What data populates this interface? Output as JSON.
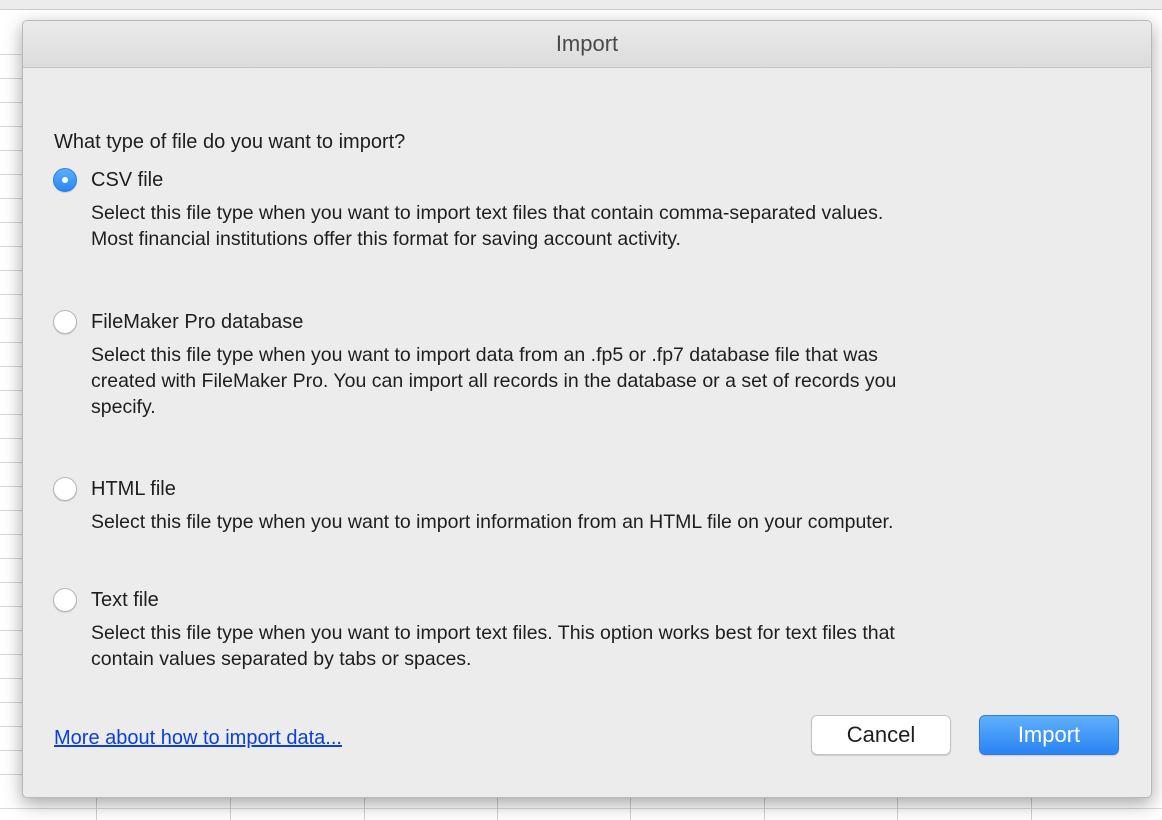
{
  "dialog": {
    "title": "Import",
    "question": "What type of file do you want to import?",
    "options": [
      {
        "label": "CSV file",
        "selected": true,
        "description": [
          "Select this file type when you want to import text files that contain comma-separated values.",
          "Most financial institutions offer this format for saving account activity."
        ]
      },
      {
        "label": "FileMaker Pro database",
        "selected": false,
        "description": [
          "Select this file type when you want to import data from an .fp5 or .fp7 database file that was",
          "created with FileMaker Pro.  You can import all records in the database or a set of records you",
          "specify."
        ]
      },
      {
        "label": "HTML file",
        "selected": false,
        "description": [
          "Select this file type when you want to import information from an HTML file on your computer."
        ]
      },
      {
        "label": "Text file",
        "selected": false,
        "description": [
          "Select this file type when you want to import text files.  This option works best for text files that",
          "contain values separated by tabs or spaces."
        ]
      }
    ],
    "help_link": "More about how to import data...",
    "cancel_label": "Cancel",
    "import_label": "Import"
  },
  "colors": {
    "accent": "#2a86f5",
    "link": "#0b3fd8",
    "dialog_background": "#ececec"
  }
}
